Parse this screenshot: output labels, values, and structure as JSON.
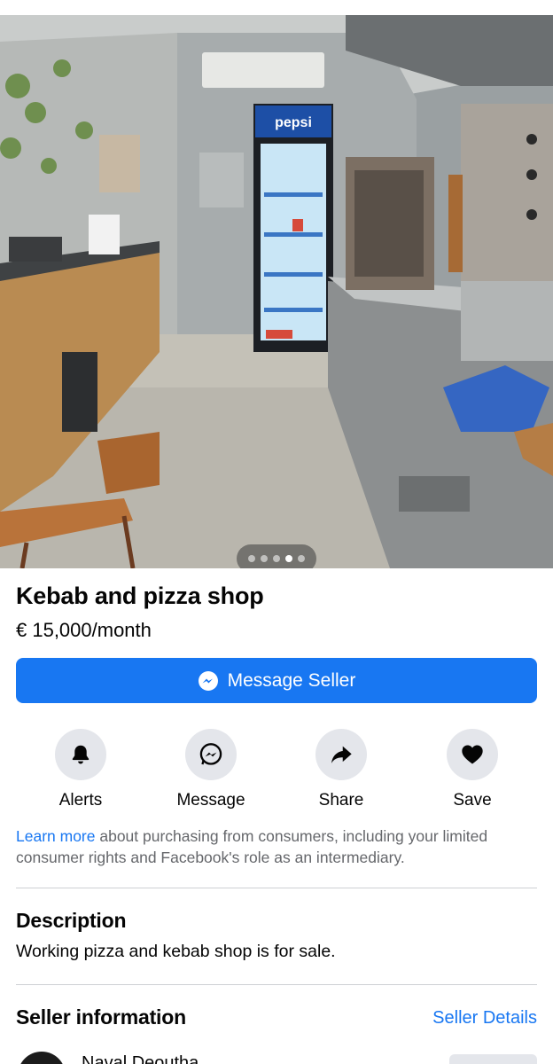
{
  "listing": {
    "photo_alt": "Interior of a kebab and pizza shop kitchen",
    "photo_count": 5,
    "photo_active_index": 3,
    "pepsi_label": "pepsi",
    "title": "Kebab and pizza shop",
    "price": "€ 15,000/month"
  },
  "primary_action": {
    "label": "Message Seller",
    "icon": "messenger-icon"
  },
  "actions": [
    {
      "label": "Alerts",
      "icon": "bell-icon"
    },
    {
      "label": "Message",
      "icon": "messenger-icon"
    },
    {
      "label": "Share",
      "icon": "share-arrow-icon"
    },
    {
      "label": "Save",
      "icon": "heart-icon"
    }
  ],
  "consumer_info": {
    "link_text": "Learn more",
    "text": " about purchasing from consumers, including your limited consumer rights and Facebook's role as an intermediary."
  },
  "description": {
    "heading": "Description",
    "text": "Working pizza and kebab shop is for sale."
  },
  "seller": {
    "heading": "Seller information",
    "details_link": "Seller Details",
    "name": "Naval Deoutha"
  },
  "colors": {
    "accent": "#1877f2",
    "secondary_button": "#e4e6eb",
    "muted_text": "#65676b"
  }
}
